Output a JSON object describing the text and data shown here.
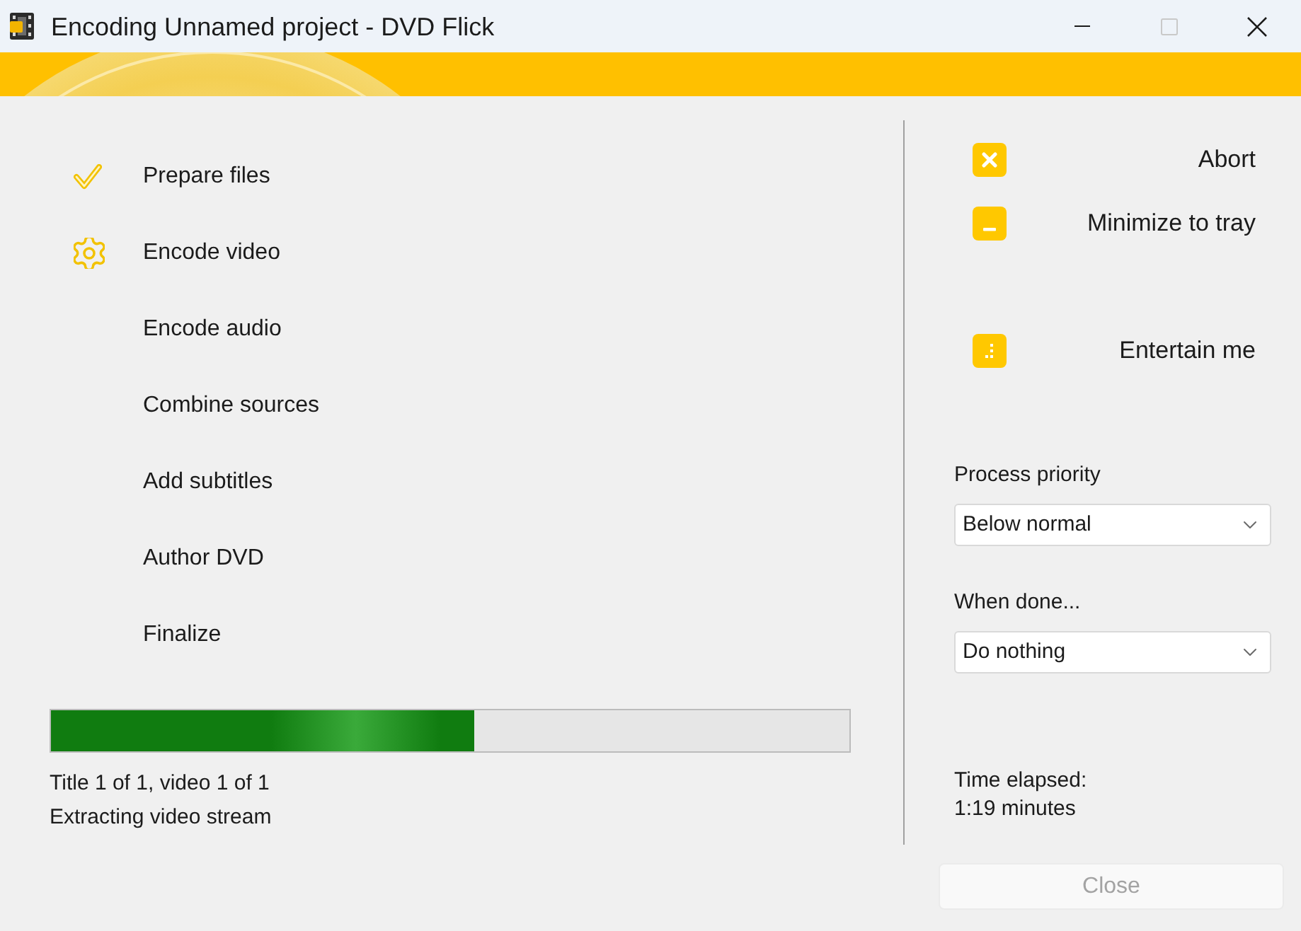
{
  "window": {
    "title": "Encoding Unnamed project - DVD Flick",
    "controls": [
      {
        "kind": "minimize",
        "disabled": false
      },
      {
        "kind": "maximize",
        "disabled": true
      },
      {
        "kind": "close",
        "disabled": false
      }
    ]
  },
  "steps": [
    {
      "label": "Prepare files",
      "done": true,
      "active": false
    },
    {
      "label": "Encode video",
      "done": false,
      "active": true
    },
    {
      "label": "Encode audio",
      "done": false,
      "active": false
    },
    {
      "label": "Combine sources",
      "done": false,
      "active": false
    },
    {
      "label": "Add subtitles",
      "done": false,
      "active": false
    },
    {
      "label": "Author DVD",
      "done": false,
      "active": false
    },
    {
      "label": "Finalize",
      "done": false,
      "active": false
    }
  ],
  "progress": {
    "level": 0.53,
    "lines": [
      "Title 1 of 1, video 1 of 1",
      "Extracting video stream"
    ]
  },
  "actions": [
    {
      "kind": "abort",
      "label": "Abort"
    },
    {
      "kind": "minimize",
      "label": "Minimize to tray"
    },
    {
      "kind": "entertain",
      "label": "Entertain me"
    }
  ],
  "settings": [
    {
      "label": "Process priority",
      "value": "Below normal"
    },
    {
      "label": "When done...",
      "value": "Do nothing"
    }
  ],
  "time_elapsed": {
    "label": "Time elapsed:",
    "value": "1:19 minutes"
  },
  "close_button": {
    "label": "Close",
    "disabled": true
  }
}
